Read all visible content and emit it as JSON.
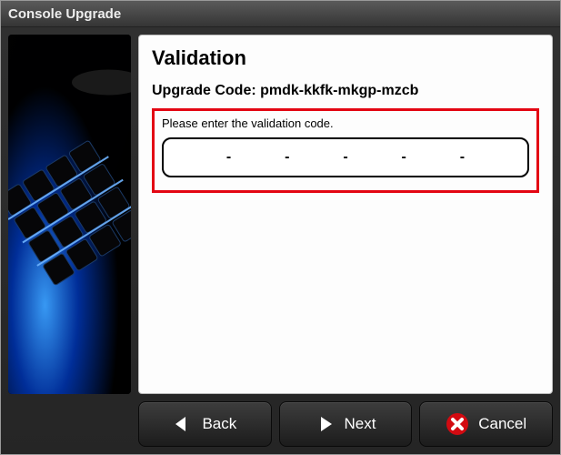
{
  "window": {
    "title": "Console Upgrade"
  },
  "panel": {
    "heading": "Validation",
    "upgrade_label": "Upgrade Code:",
    "upgrade_code": "pmdk-kkfk-mkgp-mzcb",
    "instruction": "Please enter the validation code.",
    "validation_segments": [
      "",
      "",
      "",
      "",
      "",
      ""
    ]
  },
  "buttons": {
    "back": "Back",
    "next": "Next",
    "cancel": "Cancel"
  }
}
